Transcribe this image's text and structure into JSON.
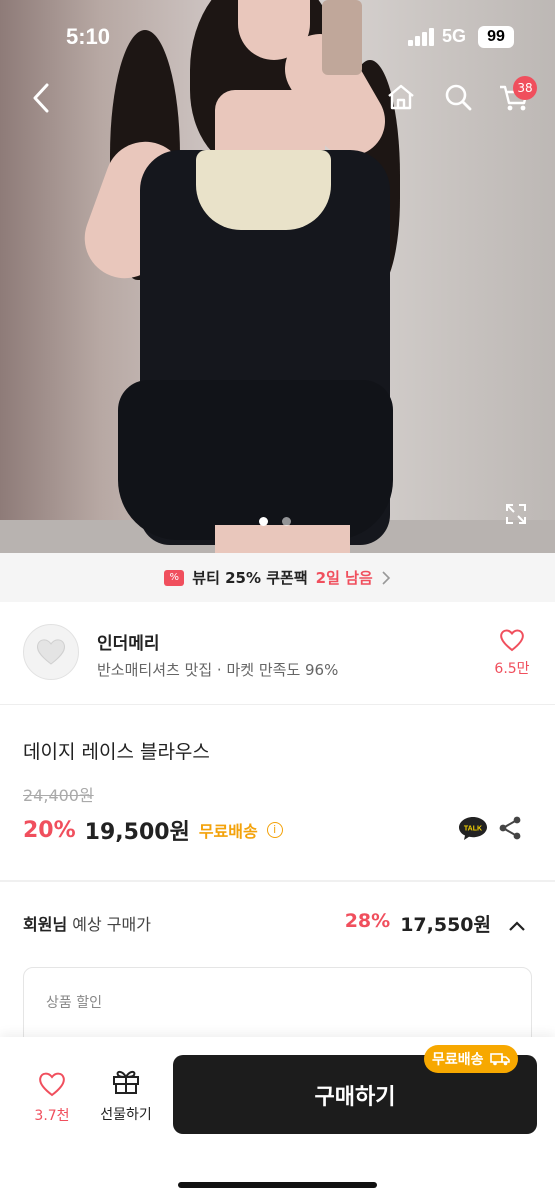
{
  "status_bar": {
    "time": "5:10",
    "network": "5G",
    "battery": "99"
  },
  "nav": {
    "back_icon": "chevron-left-icon",
    "home_icon": "home-icon",
    "search_icon": "search-icon",
    "cart_icon": "cart-icon",
    "cart_count": "38"
  },
  "gallery": {
    "total": 2,
    "active_index": 1,
    "expand_icon": "expand-icon"
  },
  "coupon": {
    "text": "뷰티 25% 쿠폰팩",
    "remaining": "2일 남음"
  },
  "shop": {
    "name": "인더메리",
    "subtitle": "반소매티셔츠 맛집 · 마켓 만족도 96%",
    "likes": "6.5만"
  },
  "product": {
    "title": "데이지 레이스 블라우스",
    "original_price": "24,400원",
    "discount": "20%",
    "price": "19,500원",
    "shipping": "무료배송",
    "talk_label": "TALK"
  },
  "member": {
    "label_bold": "회원님",
    "label_rest": " 예상 구매가",
    "discount": "28%",
    "price": "17,550원"
  },
  "discount_box": {
    "label": "상품 할인"
  },
  "bottom_bar": {
    "likes": "3.7천",
    "gift_label": "선물하기",
    "buy_label": "구매하기",
    "free_shipping": "무료배송"
  },
  "colors": {
    "accent": "#f04f5d",
    "shipping": "#f3a20a",
    "buy_button": "#1c1c1c"
  }
}
